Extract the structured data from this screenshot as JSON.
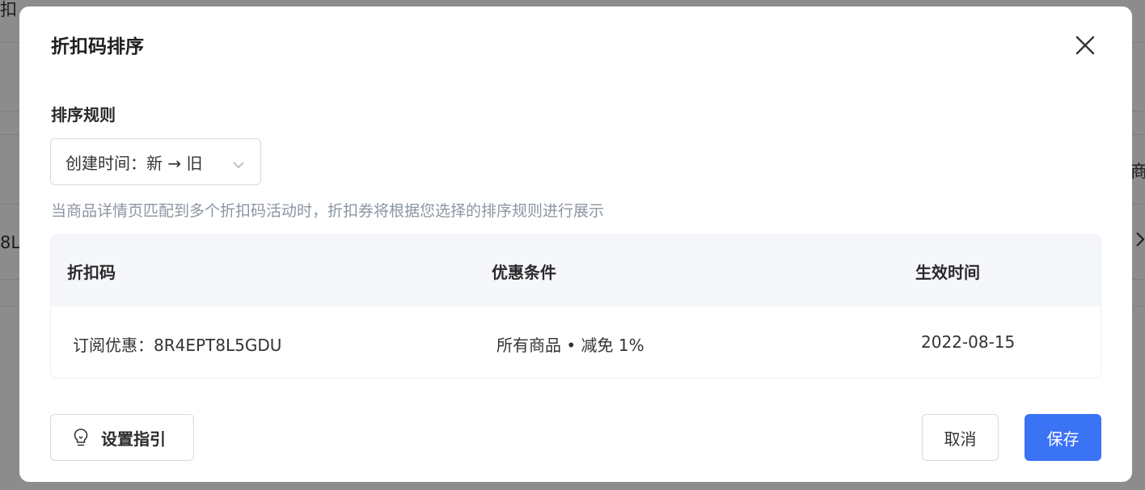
{
  "background": {
    "fragments": [
      "扣",
      "商",
      "8L"
    ]
  },
  "modal": {
    "title": "折扣码排序",
    "close_icon": "close-icon",
    "sort_section": {
      "label": "排序规则",
      "selected": "创建时间：新 → 旧",
      "chevron_icon": "chevron-down-icon"
    },
    "hint": "当商品详情页匹配到多个折扣码活动时，折扣券将根据您选择的排序规则进行展示",
    "table": {
      "columns": [
        "折扣码",
        "优惠条件",
        "生效时间"
      ],
      "rows": [
        {
          "code": "订阅优惠：8R4EPT8L5GDU",
          "condition": "所有商品 • 减免 1%",
          "date": "2022-08-15"
        }
      ]
    },
    "footer": {
      "guide_label": "设置指引",
      "guide_icon": "lightbulb-icon",
      "cancel_label": "取消",
      "save_label": "保存"
    }
  },
  "colors": {
    "primary": "#3b73f5",
    "hint_text": "#8c95a3",
    "table_header_bg": "#f5f7fb"
  }
}
